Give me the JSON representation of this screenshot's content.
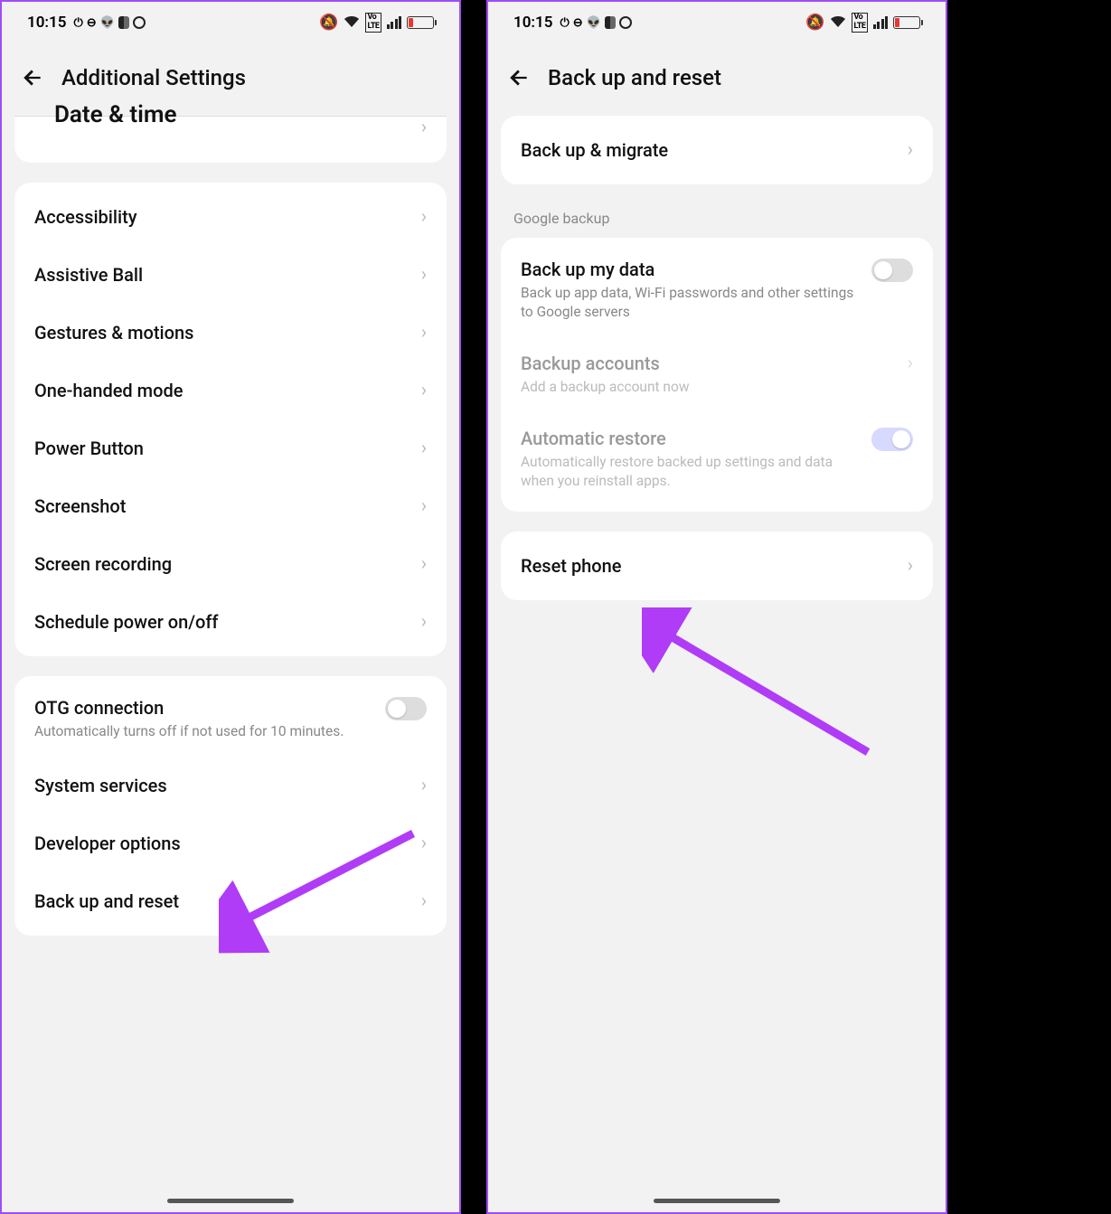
{
  "status": {
    "time": "10:15"
  },
  "screen1": {
    "title": "Additional Settings",
    "cutoff_item": "Date & time",
    "group1": [
      "Accessibility",
      "Assistive Ball",
      "Gestures & motions",
      "One-handed mode",
      "Power Button",
      "Screenshot",
      "Screen recording",
      "Schedule power on/off"
    ],
    "otg": {
      "title": "OTG connection",
      "sub": "Automatically turns off if not used for 10 minutes."
    },
    "group2": [
      "System services",
      "Developer options",
      "Back up and reset"
    ]
  },
  "screen2": {
    "title": "Back up and reset",
    "backup_migrate": "Back up & migrate",
    "section_label": "Google backup",
    "backup_my_data": {
      "title": "Back up my data",
      "sub": "Back up app data, Wi-Fi passwords and other settings to Google servers"
    },
    "backup_accounts": {
      "title": "Backup accounts",
      "sub": "Add a backup account now"
    },
    "auto_restore": {
      "title": "Automatic restore",
      "sub": "Automatically restore backed up settings and data when you reinstall apps."
    },
    "reset_phone": "Reset phone"
  }
}
